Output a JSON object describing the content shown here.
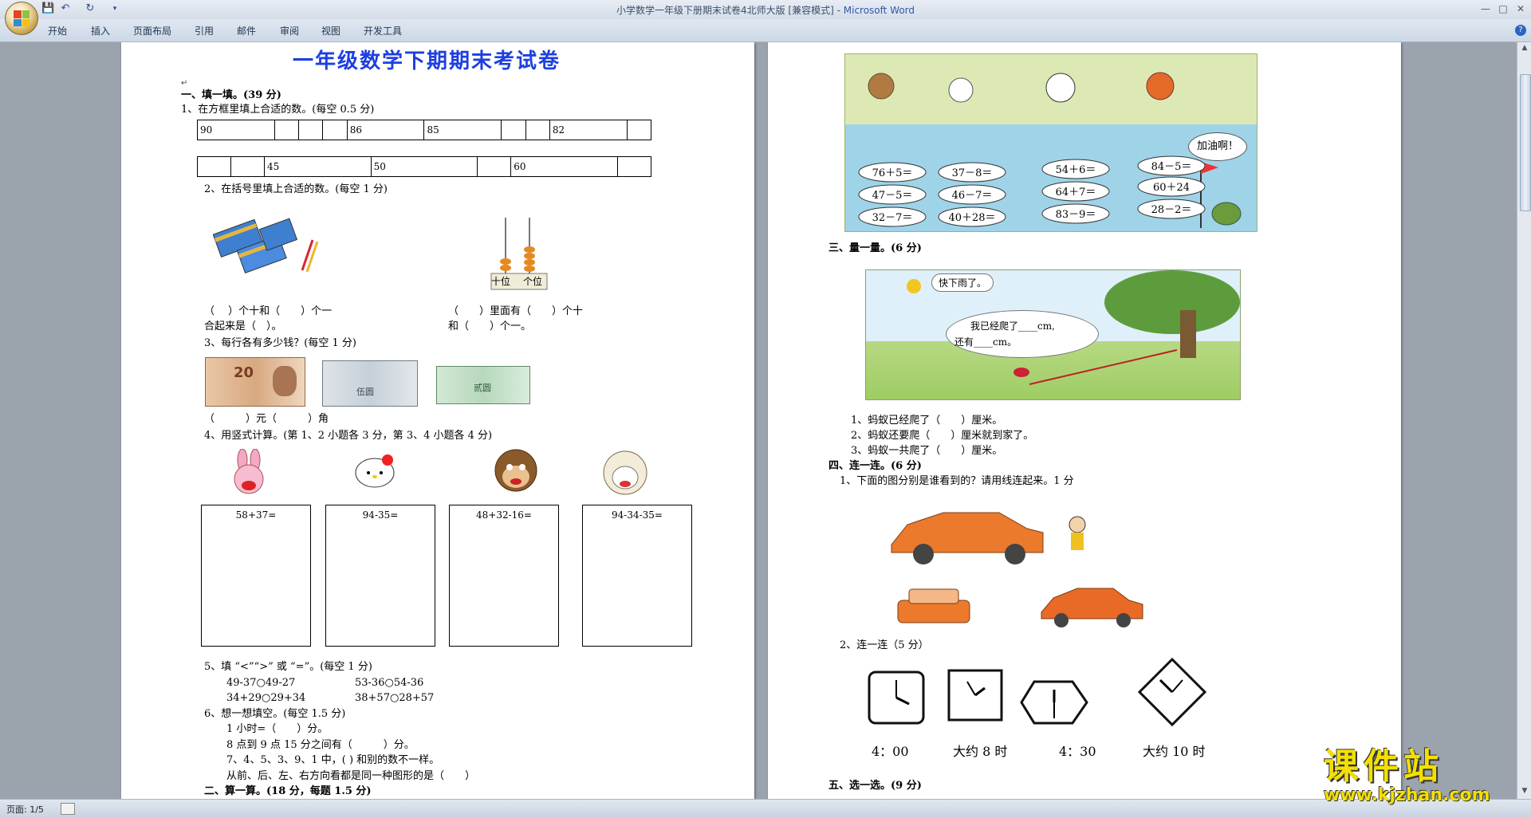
{
  "window": {
    "title": "小学数学一年级下册期末试卷4北师大版 [兼容模式] - ",
    "app_name": "Microsoft Word",
    "qa_icons": [
      "save-icon",
      "undo-icon",
      "redo-icon",
      "customize-icon"
    ]
  },
  "ribbon": {
    "tabs": [
      "开始",
      "插入",
      "页面布局",
      "引用",
      "邮件",
      "审阅",
      "视图",
      "开发工具"
    ],
    "help_label": "?"
  },
  "page1": {
    "title": "一年级数学下期期末考试卷",
    "sec1": "一、填一填。(39 分)",
    "q1": "1、在方框里填上合适的数。(每空 0.5 分)",
    "row1": [
      "90",
      "",
      "",
      "",
      "86",
      "85",
      "",
      "",
      "82",
      ""
    ],
    "row2": [
      "",
      "",
      "45",
      "50",
      "",
      "60",
      ""
    ],
    "q2": "2、在括号里填上合适的数。(每空 1 分)",
    "abacus_tens": "十位",
    "abacus_ones": "个位",
    "q2a1": "（　 ）个十和（　　）个一",
    "q2a2": "合起来是（　）。",
    "q2b1": "（　　）里面有（　　）个十",
    "q2b2": "和（　　）个一。",
    "q3": "3、每行各有多少钱？(每空 1 分)",
    "money_20": "20",
    "money_50": "伍圆",
    "money_2": "贰圆",
    "q3a": "（　　　）元（　　　）角",
    "q4": "4、用竖式计算。(第 1、2 小题各 3 分，第 3、4 小题各 4 分)",
    "calc": [
      "58+37=",
      "94-35=",
      "48+32-16=",
      "94-34-35="
    ],
    "q5": "5、填 “<”“>” 或 “=”。(每空 1 分)",
    "q5a": "49-37○49-27",
    "q5b": "53-36○54-36",
    "q5c": "34+29○29+34",
    "q5d": "38+57○28+57",
    "q6": "6、想一想填空。(每空 1.5 分)",
    "q6a": "1 小时=（　　）分。",
    "q6b": "8 点到 9 点 15 分之间有（　　　）分。",
    "q6c": "7、4、5、3、9、1 中，(  ) 和别的数不一样。",
    "q6d": "从前、后、左、右方向看都是同一种图形的是（　　）",
    "sec2": "二、算一算。(18 分，每题 1.5 分)"
  },
  "page2": {
    "exprs": [
      "76＋5＝",
      "37－8＝",
      "54＋6＝",
      "84－5＝",
      "47－5＝",
      "46－7＝",
      "64＋7＝",
      "60＋24",
      "32－7＝",
      "40＋28＝",
      "83－9＝",
      "28－2＝"
    ],
    "cheer": "加油啊！",
    "sec3": "三、量一量。(6 分)",
    "bird_says": "快下雨了。",
    "ant_says1": "我已经爬了____cm,",
    "ant_says2": "还有____cm。",
    "q3a": "1、蚂蚁已经爬了（　　）厘米。",
    "q3b": "2、蚂蚁还要爬（　　）厘米就到家了。",
    "q3c": "3、蚂蚁一共爬了（　　）厘米。",
    "sec4": "四、连一连。(6 分)",
    "q4a": "1、下面的图分别是谁看到的？请用线连起来。1 分",
    "q4b": "2、连一连（5 分）",
    "clock_labels": [
      "4：00",
      "大约 8 时",
      "4：30",
      "大约 10 时"
    ],
    "sec5": "五、选一选。(9 分)"
  },
  "status": {
    "page": "页面: 1/5"
  },
  "watermark": {
    "name": "课件站",
    "url": "www.kjzhan.com"
  },
  "colors": {
    "title_blue": "#1d3fe0",
    "watermark_yellow": "#f4e000",
    "page_bg": "#ffffff",
    "workspace_bg": "#9ba3ad"
  }
}
